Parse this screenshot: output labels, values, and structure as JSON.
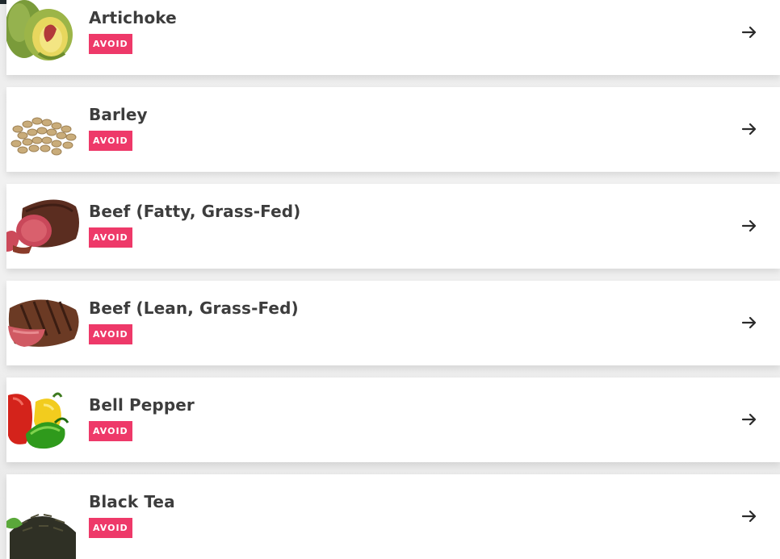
{
  "foods": [
    {
      "name": "Artichoke",
      "badge": "AVOID",
      "image_icon": "artichoke-image"
    },
    {
      "name": "Barley",
      "badge": "AVOID",
      "image_icon": "barley-image"
    },
    {
      "name": "Beef (Fatty, Grass-Fed)",
      "badge": "AVOID",
      "image_icon": "roast-beef-image"
    },
    {
      "name": "Beef (Lean, Grass-Fed)",
      "badge": "AVOID",
      "image_icon": "steak-image"
    },
    {
      "name": "Bell Pepper",
      "badge": "AVOID",
      "image_icon": "bell-pepper-image"
    },
    {
      "name": "Black Tea",
      "badge": "AVOID",
      "image_icon": "black-tea-image"
    }
  ],
  "colors": {
    "badge_background": "#ee3969",
    "title_text": "#3d3d3d",
    "top_bar": "#222a30"
  },
  "row_action_icon": "arrow-right-icon"
}
